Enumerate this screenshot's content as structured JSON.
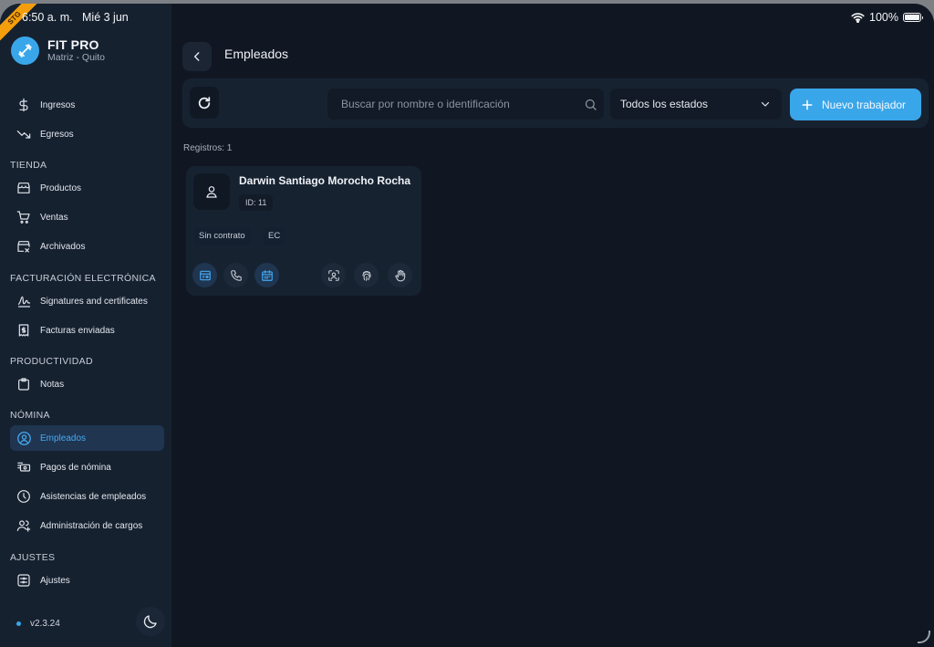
{
  "status_bar": {
    "time": "6:50 a. m.",
    "date": "Mié 3 jun",
    "battery": "100%",
    "battery_level": 1.0
  },
  "ribbon": {
    "text": "STG"
  },
  "brand": {
    "name": "FIT PRO",
    "subtitle": "Matriz - Quito",
    "logo_icon": "dumbbell-icon",
    "logo_color": "#3aa6ea"
  },
  "sidebar": {
    "items": [
      {
        "label": "Ingresos",
        "icon": "dollar-icon"
      },
      {
        "label": "Egresos",
        "icon": "trend-down-icon"
      },
      {
        "label": "Productos",
        "icon": "store-icon"
      },
      {
        "label": "Ventas",
        "icon": "cart-icon"
      },
      {
        "label": "Archivados",
        "icon": "archive-store-icon"
      },
      {
        "label": "Signatures and certificates",
        "icon": "signature-icon"
      },
      {
        "label": "Facturas enviadas",
        "icon": "invoice-icon"
      },
      {
        "label": "Notas",
        "icon": "clipboard-icon"
      },
      {
        "label": "Empleados",
        "icon": "user-circle-icon",
        "active": true
      },
      {
        "label": "Pagos de nómina",
        "icon": "cash-icon"
      },
      {
        "label": "Asistencias de empleados",
        "icon": "clock-icon"
      },
      {
        "label": "Administración de cargos",
        "icon": "users-plus-icon"
      },
      {
        "label": "Ajustes",
        "icon": "settings-icon"
      }
    ],
    "sections": [
      "TIENDA",
      "FACTURACIÓN ELECTRÓNICA",
      "PRODUCTIVIDAD",
      "NÓMINA",
      "AJUSTES"
    ],
    "version": "v2.3.24",
    "accent_color": "#47a9f2"
  },
  "header": {
    "title": "Empleados"
  },
  "toolbar": {
    "search_placeholder": "Buscar por nombre o identificación",
    "status_filter": "Todos los estados",
    "new_button": "Nuevo trabajador"
  },
  "records_label": "Registros: 1",
  "employee": {
    "name": "Darwin Santiago Morocho Rocha",
    "id": "ID: 11",
    "contract": "Sin contrato",
    "country": "EC"
  }
}
